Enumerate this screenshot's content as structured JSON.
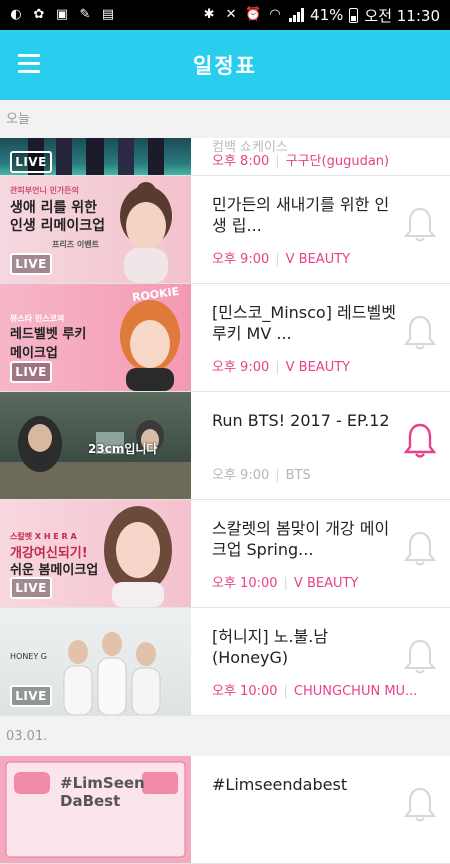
{
  "status_bar": {
    "battery": "41%",
    "time": "오전 11:30"
  },
  "header": {
    "title": "일정표",
    "menu_icon": "hamburger-menu-icon"
  },
  "today_label": "오늘",
  "partial_item": {
    "title": "컴백 쇼케이스",
    "time": "오후 8:00",
    "channel": "구구단(gugudan)"
  },
  "items": [
    {
      "thumb_line1": "관피부언니 민가든의",
      "thumb_line2": "생애 리를 위한",
      "thumb_line3": "인생 리메이크업",
      "thumb_line4": "프리즈 이벤트",
      "live": "LIVE",
      "title": "민가든의 새내기를 위한 인생 립...",
      "time": "오후 9:00",
      "channel": "V BEAUTY",
      "alarm_on": false
    },
    {
      "thumb_line1": "뷰스타 민스코의",
      "thumb_line2": "레드벨벳 루키",
      "thumb_line3": "메이크업",
      "thumb_tag": "ROOKIE",
      "live": "LIVE",
      "title": "[민스코_Minsco] 레드벨벳 루키 MV ...",
      "time": "오후 9:00",
      "channel": "V BEAUTY",
      "alarm_on": false
    },
    {
      "thumb_caption": "23cm입니다",
      "title": "Run BTS! 2017 - EP.12",
      "time": "오후 9:00",
      "channel": "BTS",
      "alarm_on": true
    },
    {
      "thumb_line1": "스칼렛 X H E R A",
      "thumb_line2": "개강여신되기!",
      "thumb_line3": "쉬운 봄메이크업",
      "live": "LIVE",
      "title": "스칼렛의 봄맞이 개강 메이크업 Spring...",
      "time": "오후 10:00",
      "channel": "V BEAUTY",
      "alarm_on": false
    },
    {
      "thumb_line1": "HONEY G",
      "live": "LIVE",
      "title": "[허니지] 노.불.남 (HoneyG)",
      "time": "오후 10:00",
      "channel": "CHUNGCHUN MU...",
      "alarm_on": false
    }
  ],
  "date_divider": "03.01.",
  "next_item": {
    "thumb_line1": "#LimSeen",
    "thumb_line2": "DaBest",
    "title": "#Limseendabest",
    "alarm_on": false
  },
  "colors": {
    "header": "#29ceef",
    "accent_pink": "#e8418a",
    "muted": "#9a9a9a"
  }
}
